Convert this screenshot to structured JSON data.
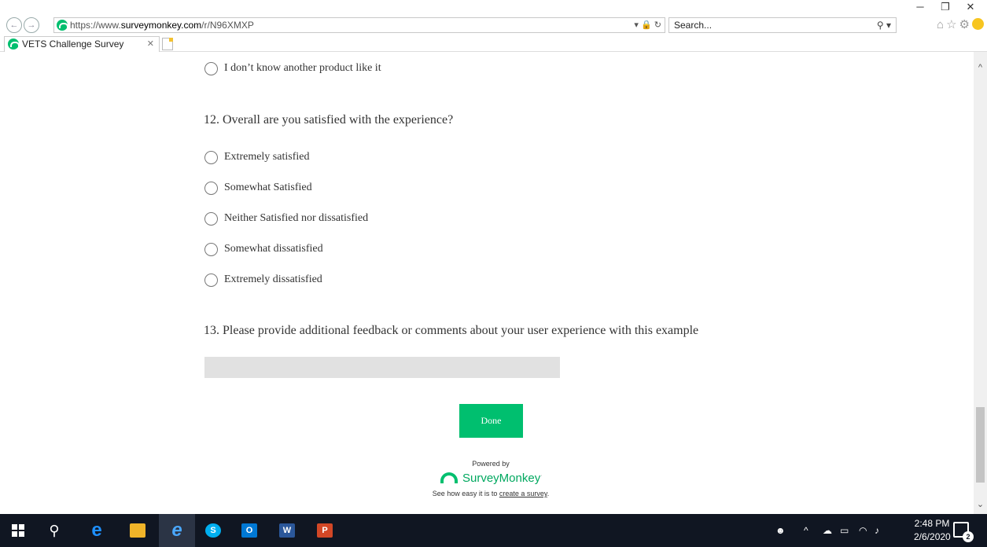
{
  "browser": {
    "url_prefix": "https://www.",
    "url_domain": "surveymonkey.com",
    "url_path": "/r/N96XMXP",
    "search_placeholder": "Search...",
    "tab_title": "VETS Challenge Survey"
  },
  "survey": {
    "prev_option": "I don’t know another product like it",
    "q12": {
      "text": "12. Overall are you satisfied with the experience?",
      "options": [
        "Extremely satisfied",
        "Somewhat Satisfied",
        "Neither Satisfied nor dissatisfied",
        "Somewhat dissatisfied",
        "Extremely dissatisfied"
      ]
    },
    "q13": {
      "text": "13. Please provide additional feedback or comments about your user experience with this example"
    },
    "done_label": "Done",
    "powered_by": "Powered by",
    "brand": "SurveyMonkey",
    "create_text": "See how easy it is to ",
    "create_link": "create a survey",
    "create_end": ".",
    "brand_color": "#00bf6f"
  },
  "taskbar": {
    "time": "2:48 PM",
    "date": "2/6/2020",
    "notification_count": "2"
  }
}
